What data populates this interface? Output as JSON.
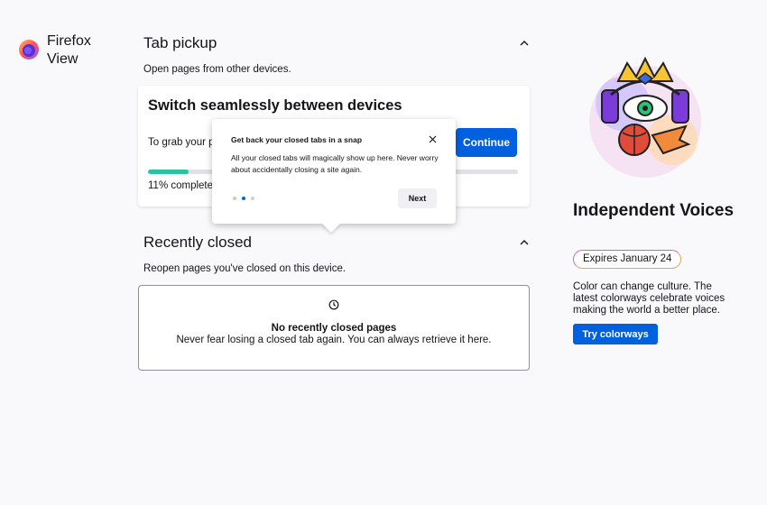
{
  "app": {
    "title": "Firefox View"
  },
  "tab_pickup": {
    "heading": "Tab pickup",
    "subtitle": "Open pages from other devices.",
    "card_title": "Switch seamlessly between devices",
    "card_text": "To grab your p",
    "continue_label": "Continue",
    "progress_fraction": 0.11,
    "progress_text": "11% complete"
  },
  "recently_closed": {
    "heading": "Recently closed",
    "subtitle": "Reopen pages you've closed on this device.",
    "empty_title": "No recently closed pages",
    "empty_text": "Never fear losing a closed tab again. You can always retrieve it here."
  },
  "callout": {
    "title": "Get back your closed tabs in a snap",
    "body": "All your closed tabs will magically show up here. Never worry about accidentally closing a site again.",
    "next_label": "Next",
    "steps": 3,
    "current_step": 2
  },
  "promo": {
    "title": "Independent Voices",
    "badge": "Expires January 24",
    "body": "Color can change culture. The latest colorways celebrate voices making the world a better place.",
    "cta_label": "Try colorways"
  },
  "colors": {
    "accent": "#0061e0",
    "progress": "#2ac3a2"
  },
  "icons": [
    "firefox-logo",
    "chevron-up-icon",
    "clock-icon",
    "close-icon"
  ]
}
